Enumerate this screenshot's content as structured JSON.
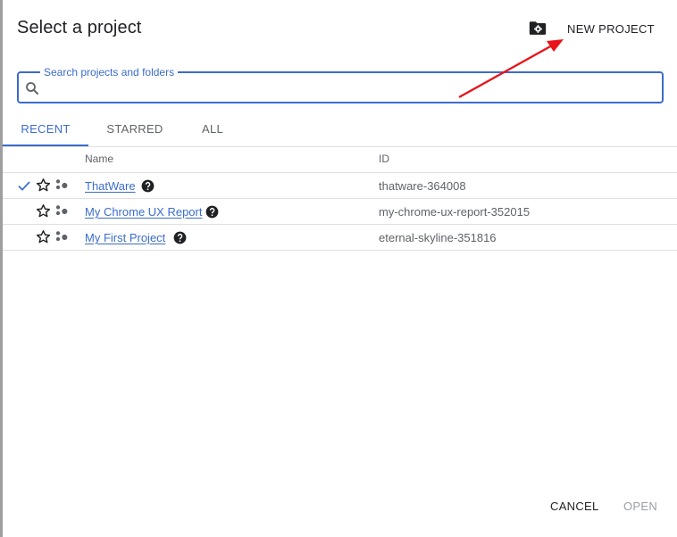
{
  "dialog": {
    "title": "Select a project",
    "new_project_label": "NEW PROJECT",
    "icons": {
      "new_project": "folder-gear-icon",
      "search": "search-icon",
      "check": "check-icon",
      "star": "star-outline-icon",
      "org": "organization-icon",
      "help": "help-circle-icon"
    }
  },
  "search": {
    "label": "Search projects and folders",
    "value": ""
  },
  "tabs": [
    {
      "label": "RECENT",
      "active": true
    },
    {
      "label": "STARRED",
      "active": false
    },
    {
      "label": "ALL",
      "active": false
    }
  ],
  "table": {
    "headers": {
      "name": "Name",
      "id": "ID"
    },
    "rows": [
      {
        "name": "ThatWare",
        "id": "thatware-364008",
        "selected": true
      },
      {
        "name": "My Chrome UX Report",
        "id": "my-chrome-ux-report-352015",
        "selected": false
      },
      {
        "name": "My First Project",
        "id": "eternal-skyline-351816",
        "selected": false
      }
    ]
  },
  "footer": {
    "cancel_label": "CANCEL",
    "open_label": "OPEN"
  },
  "colors": {
    "accent": "#3b6ccc",
    "annotation_arrow": "#e8141b",
    "disabled": "#9aa0a6"
  }
}
